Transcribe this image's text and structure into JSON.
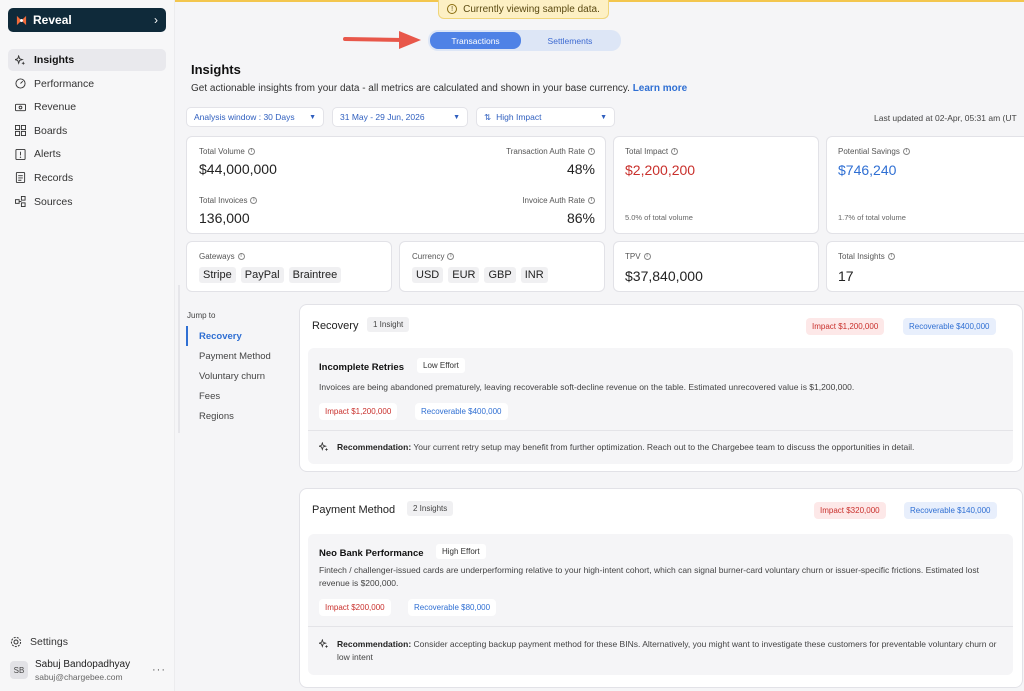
{
  "sidebar": {
    "brand": "Reveal",
    "items": [
      {
        "label": "Insights",
        "icon": "sparkle-icon"
      },
      {
        "label": "Performance",
        "icon": "gauge-icon"
      },
      {
        "label": "Revenue",
        "icon": "money-icon"
      },
      {
        "label": "Boards",
        "icon": "boards-icon"
      },
      {
        "label": "Alerts",
        "icon": "alert-icon"
      },
      {
        "label": "Records",
        "icon": "records-icon"
      },
      {
        "label": "Sources",
        "icon": "sources-icon"
      }
    ],
    "settings": "Settings",
    "user": {
      "initials": "SB",
      "name": "Sabuj Bandopadhyay",
      "email": "sabuj@chargebee.com"
    }
  },
  "banner": "Currently viewing sample data.",
  "toggle": {
    "left": "Transactions",
    "right": "Settlements",
    "selected": "Transactions"
  },
  "header": {
    "title": "Insights",
    "subtitle": "Get actionable insights from your data - all metrics are calculated and shown in your base currency.",
    "learn_more": "Learn more"
  },
  "filters": {
    "window": "Analysis window : 30 Days",
    "dates": "31 May - 29 Jun, 2026",
    "sort": "High Impact",
    "updated": "Last updated at 02-Apr, 05:31 am (UT"
  },
  "metrics": {
    "total_volume": {
      "label": "Total Volume",
      "value": "$44,000,000"
    },
    "txn_auth_rate": {
      "label": "Transaction Auth Rate",
      "value": "48%"
    },
    "total_invoices": {
      "label": "Total Invoices",
      "value": "136,000"
    },
    "invoice_auth_rate": {
      "label": "Invoice Auth Rate",
      "value": "86%"
    },
    "total_impact": {
      "label": "Total Impact",
      "value": "$2,200,200",
      "note": "5.0% of total volume"
    },
    "potential_savings": {
      "label": "Potential Savings",
      "value": "$746,240",
      "note": "1.7% of total volume"
    },
    "gateways": {
      "label": "Gateways",
      "items": [
        "Stripe",
        "PayPal",
        "Braintree"
      ]
    },
    "currency": {
      "label": "Currency",
      "items": [
        "USD",
        "EUR",
        "GBP",
        "INR"
      ]
    },
    "tpv": {
      "label": "TPV",
      "value": "$37,840,000"
    },
    "total_insights": {
      "label": "Total Insights",
      "value": "17"
    }
  },
  "jump": {
    "title": "Jump to",
    "items": [
      "Recovery",
      "Payment Method",
      "Voluntary churn",
      "Fees",
      "Regions"
    ]
  },
  "sections": [
    {
      "title": "Recovery",
      "count": "1 Insight",
      "impact": "Impact $1,200,000",
      "recoverable": "Recoverable $400,000",
      "insight": {
        "title": "Incomplete Retries",
        "effort": "Low Effort",
        "description": "Invoices are being abandoned prematurely, leaving recoverable soft-decline revenue on the table. Estimated unrecovered value is $1,200,000.",
        "impact": "Impact $1,200,000",
        "recoverable": "Recoverable $400,000",
        "rec_label": "Recommendation:",
        "rec_text": "Your current retry setup may benefit from further optimization. Reach out to the Chargebee team to discuss the opportunities in detail."
      }
    },
    {
      "title": "Payment Method",
      "count": "2 Insights",
      "impact": "Impact $320,000",
      "recoverable": "Recoverable $140,000",
      "insight": {
        "title": "Neo Bank Performance",
        "effort": "High Effort",
        "description": "Fintech / challenger-issued cards are underperforming relative to your high-intent cohort, which can signal burner-card voluntary churn or issuer-specific frictions. Estimated lost revenue is $200,000.",
        "impact": "Impact $200,000",
        "recoverable": "Recoverable $80,000",
        "rec_label": "Recommendation:",
        "rec_text": "Consider accepting backup payment method for these BINs. Alternatively, you might want to investigate these customers for preventable voluntary churn or low intent"
      }
    }
  ],
  "colors": {
    "accent": "#2f6fd3",
    "impact": "#c9302c",
    "brand_bg": "#0f2a3a",
    "banner": "#fdf0c4"
  }
}
